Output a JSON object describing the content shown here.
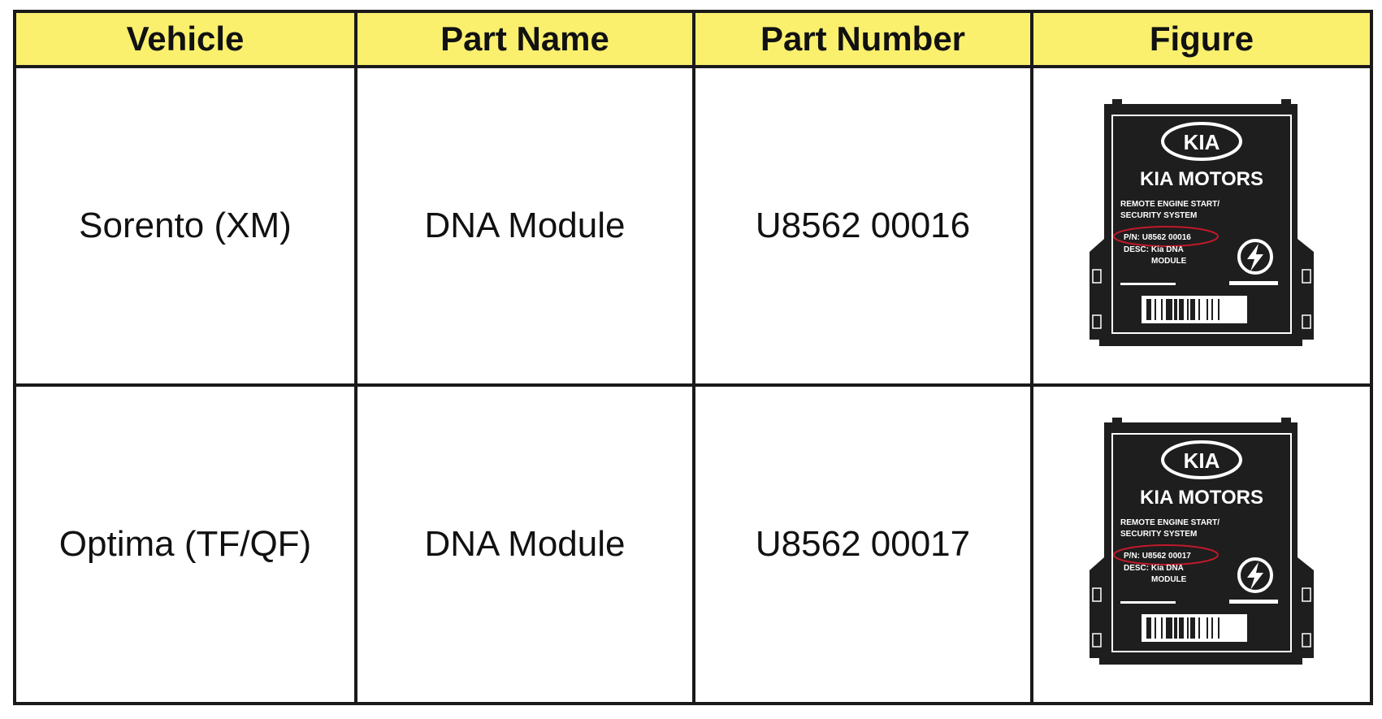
{
  "colors": {
    "header_background": "#faf06e",
    "border": "#1a1a1a",
    "module_body": "#1e1e1e",
    "module_text": "#ffffff",
    "highlight_ellipse": "#c0192a"
  },
  "table": {
    "headers": [
      "Vehicle",
      "Part Name",
      "Part Number",
      "Figure"
    ],
    "rows": [
      {
        "vehicle": "Sorento (XM)",
        "part_name": "DNA Module",
        "part_number": "U8562 00016",
        "figure": {
          "icon": "kia-dna-module-image",
          "logo": "KIA",
          "brand": "KIA MOTORS",
          "line1": "REMOTE ENGINE START/",
          "line2": "SECURITY SYSTEM",
          "pn": "P/N: U8562 00016",
          "desc1": "DESC: Kia DNA",
          "desc2": "MODULE"
        }
      },
      {
        "vehicle": "Optima (TF/QF)",
        "part_name": "DNA Module",
        "part_number": "U8562 00017",
        "figure": {
          "icon": "kia-dna-module-image",
          "logo": "KIA",
          "brand": "KIA MOTORS",
          "line1": "REMOTE ENGINE START/",
          "line2": "SECURITY SYSTEM",
          "pn": "P/N: U8562 00017",
          "desc1": "DESC: Kia DNA",
          "desc2": "MODULE"
        }
      }
    ]
  }
}
